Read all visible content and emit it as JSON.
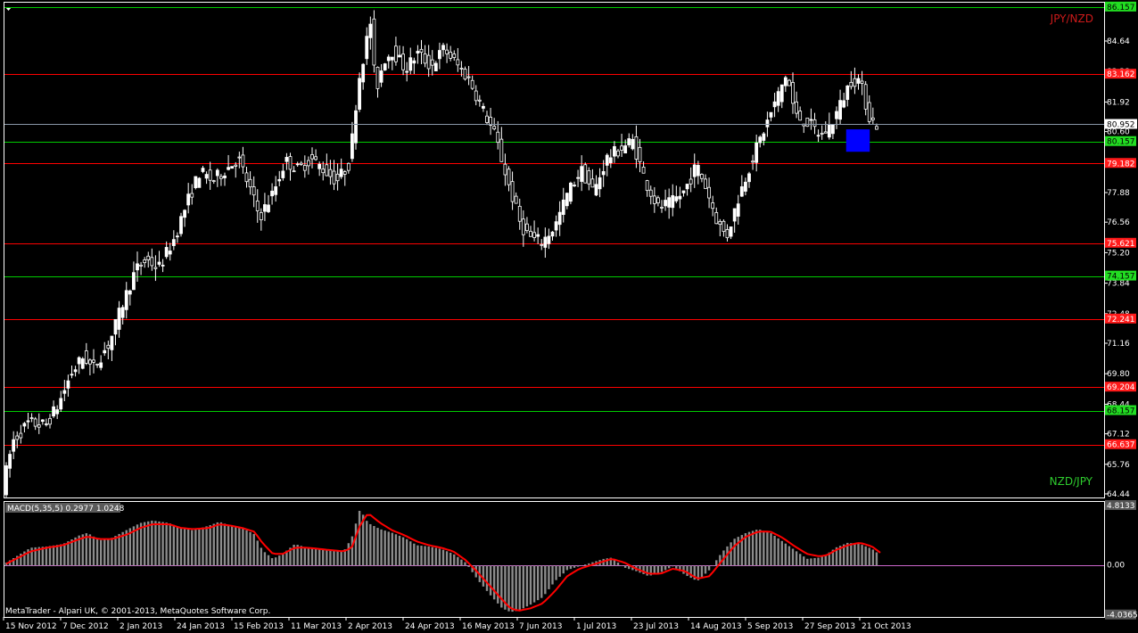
{
  "app": {
    "footer": "MetaTrader - Alpari UK, © 2001-2013, MetaQuotes Software Corp.",
    "menu_icon": "triangle-down-icon"
  },
  "colors": {
    "background": "#000000",
    "frame": "#ffffff",
    "resistance": "#ff0000",
    "support": "#00cc00",
    "price_line": "#8a97a8",
    "macd_signal": "#ff0000",
    "macd_hist": "#8c8c8c",
    "zero_line": "#cc66cc",
    "highlight": "#0000ff"
  },
  "chart_data": [
    {
      "type": "candlestick",
      "title": "JPY/NZD",
      "subtitle": "NZD/JPY",
      "y_ticks": [
        86.157,
        84.64,
        83.28,
        81.92,
        80.952,
        80.6,
        79.24,
        77.88,
        76.56,
        75.2,
        73.84,
        72.48,
        71.16,
        69.8,
        68.44,
        67.12,
        65.76,
        64.44
      ],
      "ylim": [
        64.28,
        86.35
      ],
      "x_ticks": [
        "15 Nov 2012",
        "7 Dec 2012",
        "2 Jan 2013",
        "24 Jan 2013",
        "15 Feb 2013",
        "11 Mar 2013",
        "2 Apr 2013",
        "24 Apr 2013",
        "16 May 2013",
        "7 Jun 2013",
        "1 Jul 2013",
        "23 Jul 2013",
        "14 Aug 2013",
        "5 Sep 2013",
        "27 Sep 2013",
        "21 Oct 2013"
      ],
      "current_price": 80.952,
      "levels": [
        {
          "value": 86.157,
          "label": "86.157",
          "kind": "support"
        },
        {
          "value": 83.162,
          "label": "83.162",
          "kind": "resistance"
        },
        {
          "value": 80.157,
          "label": "80.157",
          "kind": "support"
        },
        {
          "value": 79.182,
          "label": "79.182",
          "kind": "resistance"
        },
        {
          "value": 75.621,
          "label": "75.621",
          "kind": "resistance"
        },
        {
          "value": 74.157,
          "label": "74.157",
          "kind": "support"
        },
        {
          "value": 72.241,
          "label": "72.241",
          "kind": "resistance"
        },
        {
          "value": 69.204,
          "label": "69.204",
          "kind": "resistance"
        },
        {
          "value": 68.157,
          "label": "68.157",
          "kind": "support"
        },
        {
          "value": 66.637,
          "label": "66.637",
          "kind": "resistance"
        }
      ],
      "highlight_zone": {
        "x_start": 0.963,
        "x_end": 0.99,
        "y_low": 79.7,
        "y_high": 80.7
      },
      "price_path": [
        [
          0,
          64.7
        ],
        [
          0.012,
          66.8
        ],
        [
          0.03,
          67.6
        ],
        [
          0.05,
          67.5
        ],
        [
          0.065,
          68.4
        ],
        [
          0.08,
          69.8
        ],
        [
          0.095,
          70.6
        ],
        [
          0.105,
          70.0
        ],
        [
          0.125,
          71.2
        ],
        [
          0.14,
          72.9
        ],
        [
          0.155,
          74.4
        ],
        [
          0.168,
          74.9
        ],
        [
          0.182,
          74.5
        ],
        [
          0.2,
          75.8
        ],
        [
          0.215,
          77.4
        ],
        [
          0.23,
          78.8
        ],
        [
          0.245,
          78.4
        ],
        [
          0.26,
          78.9
        ],
        [
          0.275,
          79.4
        ],
        [
          0.29,
          77.9
        ],
        [
          0.3,
          76.8
        ],
        [
          0.315,
          77.8
        ],
        [
          0.33,
          79.3
        ],
        [
          0.345,
          78.9
        ],
        [
          0.36,
          79.4
        ],
        [
          0.375,
          78.9
        ],
        [
          0.39,
          78.4
        ],
        [
          0.405,
          79.2
        ],
        [
          0.415,
          82.8
        ],
        [
          0.43,
          85.6
        ],
        [
          0.435,
          82.3
        ],
        [
          0.445,
          83.8
        ],
        [
          0.455,
          84.2
        ],
        [
          0.47,
          83.4
        ],
        [
          0.485,
          84.1
        ],
        [
          0.5,
          83.5
        ],
        [
          0.515,
          84.3
        ],
        [
          0.53,
          83.6
        ],
        [
          0.545,
          82.9
        ],
        [
          0.56,
          81.6
        ],
        [
          0.575,
          80.4
        ],
        [
          0.59,
          78.3
        ],
        [
          0.605,
          76.4
        ],
        [
          0.618,
          75.8
        ],
        [
          0.63,
          75.7
        ],
        [
          0.645,
          76.4
        ],
        [
          0.66,
          77.9
        ],
        [
          0.675,
          78.9
        ],
        [
          0.69,
          77.9
        ],
        [
          0.705,
          79.4
        ],
        [
          0.72,
          79.8
        ],
        [
          0.735,
          80.2
        ],
        [
          0.75,
          78.4
        ],
        [
          0.765,
          77.2
        ],
        [
          0.78,
          77.4
        ],
        [
          0.795,
          77.9
        ],
        [
          0.81,
          79.1
        ],
        [
          0.82,
          78.2
        ],
        [
          0.835,
          76.5
        ],
        [
          0.845,
          75.9
        ],
        [
          0.86,
          77.8
        ],
        [
          0.875,
          79.4
        ],
        [
          0.89,
          80.8
        ],
        [
          0.905,
          82.2
        ],
        [
          0.915,
          83.2
        ],
        [
          0.925,
          81.3
        ],
        [
          0.94,
          81.0
        ],
        [
          0.955,
          80.4
        ],
        [
          0.967,
          80.9
        ],
        [
          0.98,
          82.0
        ],
        [
          0.99,
          82.9
        ],
        [
          1.0,
          82.9
        ],
        [
          1.012,
          81.2
        ],
        [
          1.02,
          80.9
        ]
      ]
    },
    {
      "type": "histogram+line",
      "title": "MACD(5,35,5) 0.2977 1.0248",
      "y_ticks": [
        4.8133,
        0.0,
        -4.0365
      ],
      "ylim": [
        -4.2,
        5.1
      ],
      "macd_path": [
        [
          0,
          0.2
        ],
        [
          0.03,
          1.4
        ],
        [
          0.05,
          1.5
        ],
        [
          0.07,
          1.7
        ],
        [
          0.09,
          2.4
        ],
        [
          0.1,
          2.6
        ],
        [
          0.115,
          2.0
        ],
        [
          0.13,
          2.2
        ],
        [
          0.15,
          2.9
        ],
        [
          0.165,
          3.4
        ],
        [
          0.18,
          3.6
        ],
        [
          0.2,
          3.4
        ],
        [
          0.215,
          3.0
        ],
        [
          0.23,
          2.8
        ],
        [
          0.25,
          3.2
        ],
        [
          0.262,
          3.5
        ],
        [
          0.275,
          3.2
        ],
        [
          0.29,
          3.0
        ],
        [
          0.305,
          2.5
        ],
        [
          0.315,
          1.2
        ],
        [
          0.328,
          0.5
        ],
        [
          0.34,
          0.9
        ],
        [
          0.355,
          1.7
        ],
        [
          0.37,
          1.4
        ],
        [
          0.385,
          1.3
        ],
        [
          0.4,
          1.2
        ],
        [
          0.415,
          1.1
        ],
        [
          0.425,
          2.2
        ],
        [
          0.435,
          4.5
        ],
        [
          0.445,
          3.4
        ],
        [
          0.46,
          2.9
        ],
        [
          0.475,
          2.6
        ],
        [
          0.49,
          2.2
        ],
        [
          0.505,
          1.6
        ],
        [
          0.52,
          1.5
        ],
        [
          0.535,
          1.3
        ],
        [
          0.55,
          0.9
        ],
        [
          0.565,
          0.2
        ],
        [
          0.58,
          -1.2
        ],
        [
          0.595,
          -2.4
        ],
        [
          0.61,
          -3.5
        ],
        [
          0.62,
          -3.8
        ],
        [
          0.63,
          -3.7
        ],
        [
          0.645,
          -3.2
        ],
        [
          0.66,
          -2.6
        ],
        [
          0.675,
          -1.3
        ],
        [
          0.69,
          -0.4
        ],
        [
          0.705,
          -0.1
        ],
        [
          0.72,
          0.2
        ],
        [
          0.735,
          0.5
        ],
        [
          0.745,
          0.6
        ],
        [
          0.76,
          -0.2
        ],
        [
          0.775,
          -0.5
        ],
        [
          0.79,
          -0.9
        ],
        [
          0.805,
          -0.6
        ],
        [
          0.82,
          -0.1
        ],
        [
          0.835,
          -0.8
        ],
        [
          0.85,
          -1.3
        ],
        [
          0.865,
          -0.4
        ],
        [
          0.88,
          1.0
        ],
        [
          0.895,
          2.1
        ],
        [
          0.91,
          2.6
        ],
        [
          0.925,
          2.9
        ],
        [
          0.94,
          2.6
        ],
        [
          0.955,
          1.9
        ],
        [
          0.97,
          1.2
        ],
        [
          0.985,
          0.5
        ],
        [
          1.0,
          0.6
        ],
        [
          1.01,
          0.9
        ],
        [
          1.02,
          1.4
        ],
        [
          1.035,
          1.8
        ],
        [
          1.05,
          1.7
        ],
        [
          1.065,
          1.3
        ],
        [
          1.075,
          0.8
        ]
      ],
      "signal_path": [
        [
          0,
          0.1
        ],
        [
          0.03,
          1.1
        ],
        [
          0.05,
          1.4
        ],
        [
          0.07,
          1.6
        ],
        [
          0.09,
          2.1
        ],
        [
          0.1,
          2.3
        ],
        [
          0.115,
          2.1
        ],
        [
          0.13,
          2.1
        ],
        [
          0.15,
          2.5
        ],
        [
          0.165,
          3.0
        ],
        [
          0.18,
          3.3
        ],
        [
          0.2,
          3.3
        ],
        [
          0.215,
          3.0
        ],
        [
          0.23,
          2.9
        ],
        [
          0.25,
          3.0
        ],
        [
          0.262,
          3.3
        ],
        [
          0.275,
          3.2
        ],
        [
          0.29,
          3.0
        ],
        [
          0.305,
          2.7
        ],
        [
          0.315,
          1.8
        ],
        [
          0.328,
          0.9
        ],
        [
          0.34,
          0.9
        ],
        [
          0.355,
          1.4
        ],
        [
          0.37,
          1.4
        ],
        [
          0.385,
          1.3
        ],
        [
          0.4,
          1.2
        ],
        [
          0.415,
          1.1
        ],
        [
          0.425,
          1.4
        ],
        [
          0.435,
          3.2
        ],
        [
          0.445,
          4.2
        ],
        [
          0.46,
          3.4
        ],
        [
          0.475,
          2.8
        ],
        [
          0.49,
          2.4
        ],
        [
          0.505,
          1.9
        ],
        [
          0.52,
          1.6
        ],
        [
          0.535,
          1.4
        ],
        [
          0.55,
          1.1
        ],
        [
          0.565,
          0.4
        ],
        [
          0.58,
          -0.6
        ],
        [
          0.595,
          -1.7
        ],
        [
          0.61,
          -2.8
        ],
        [
          0.62,
          -3.5
        ],
        [
          0.63,
          -3.7
        ],
        [
          0.645,
          -3.5
        ],
        [
          0.66,
          -3.1
        ],
        [
          0.675,
          -2.1
        ],
        [
          0.69,
          -0.9
        ],
        [
          0.705,
          -0.3
        ],
        [
          0.72,
          0.0
        ],
        [
          0.735,
          0.3
        ],
        [
          0.745,
          0.5
        ],
        [
          0.76,
          0.2
        ],
        [
          0.775,
          -0.3
        ],
        [
          0.79,
          -0.7
        ],
        [
          0.805,
          -0.7
        ],
        [
          0.82,
          -0.3
        ],
        [
          0.835,
          -0.5
        ],
        [
          0.85,
          -1.1
        ],
        [
          0.865,
          -0.9
        ],
        [
          0.88,
          0.3
        ],
        [
          0.895,
          1.5
        ],
        [
          0.91,
          2.3
        ],
        [
          0.925,
          2.7
        ],
        [
          0.94,
          2.7
        ],
        [
          0.955,
          2.2
        ],
        [
          0.97,
          1.5
        ],
        [
          0.985,
          0.9
        ],
        [
          1.0,
          0.7
        ],
        [
          1.01,
          0.8
        ],
        [
          1.02,
          1.2
        ],
        [
          1.035,
          1.6
        ],
        [
          1.05,
          1.8
        ],
        [
          1.065,
          1.5
        ],
        [
          1.075,
          1.0
        ]
      ]
    }
  ]
}
